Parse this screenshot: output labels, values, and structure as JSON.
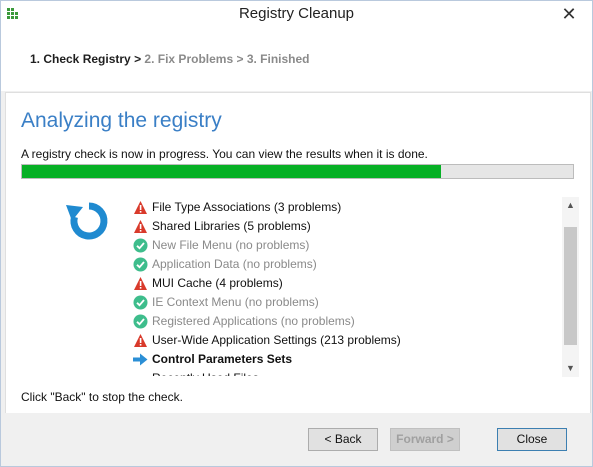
{
  "window": {
    "title": "Registry Cleanup",
    "close_symbol": "✕",
    "app_icon": "app-grid-icon"
  },
  "steps": {
    "step1": "1. Check Registry",
    "separator": ">",
    "step2": "2. Fix Problems",
    "step3": "3. Finished"
  },
  "main": {
    "heading": "Analyzing the registry",
    "description": "A registry check is now in progress. You can view the results when it is done.",
    "progress_fraction": 0.76,
    "progress_color": "#06b025",
    "hint": "Click \"Back\" to stop the check."
  },
  "results": [
    {
      "status": "problem",
      "label": "File Type Associations (3 problems)"
    },
    {
      "status": "problem",
      "label": "Shared Libraries (5 problems)"
    },
    {
      "status": "ok",
      "label": "New File Menu (no problems)"
    },
    {
      "status": "ok",
      "label": "Application Data (no problems)"
    },
    {
      "status": "problem",
      "label": "MUI Cache (4 problems)"
    },
    {
      "status": "ok",
      "label": "IE Context Menu (no problems)"
    },
    {
      "status": "ok",
      "label": "Registered Applications (no problems)"
    },
    {
      "status": "problem",
      "label": "User-Wide Application Settings (213 problems)"
    },
    {
      "status": "current",
      "label": "Control Parameters Sets"
    },
    {
      "status": "pending",
      "label": "Recently Used Files"
    }
  ],
  "scroll": {
    "up_arrow": "▲",
    "down_arrow": "▼"
  },
  "buttons": {
    "back": "< Back",
    "forward": "Forward >",
    "close": "Close"
  },
  "colors": {
    "accent": "#3a7fc6",
    "problem_red": "#d93a2b",
    "ok_green": "#3ebd8c",
    "current_blue": "#2b8fd6"
  }
}
